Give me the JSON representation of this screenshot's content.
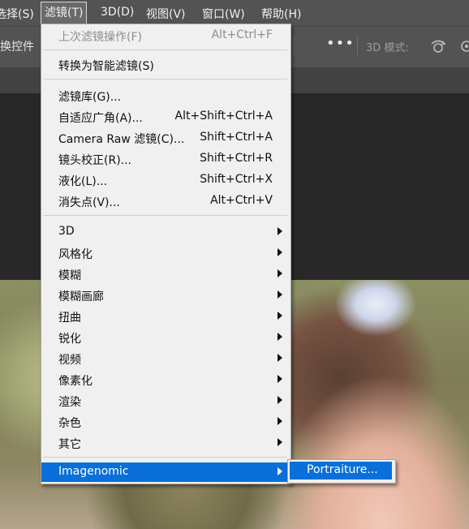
{
  "menubar": {
    "items": [
      "选择(S)",
      "滤镜(T)",
      "3D(D)",
      "视图(V)",
      "窗口(W)",
      "帮助(H)"
    ]
  },
  "options_bar": {
    "left_label": "换控件",
    "more_label": "•••",
    "mode_label": "3D 模式:"
  },
  "filter_menu": {
    "last_filter": {
      "label": "上次滤镜操作(F)",
      "shortcut": "Alt+Ctrl+F"
    },
    "convert_smart": {
      "label": "转换为智能滤镜(S)"
    },
    "group1": [
      {
        "label": "滤镜库(G)...",
        "shortcut": ""
      },
      {
        "label": "自适应广角(A)...",
        "shortcut": "Alt+Shift+Ctrl+A"
      },
      {
        "label": "Camera Raw 滤镜(C)...",
        "shortcut": "Shift+Ctrl+A"
      },
      {
        "label": "镜头校正(R)...",
        "shortcut": "Shift+Ctrl+R"
      },
      {
        "label": "液化(L)...",
        "shortcut": "Shift+Ctrl+X"
      },
      {
        "label": "消失点(V)...",
        "shortcut": "Alt+Ctrl+V"
      }
    ],
    "submenus": [
      "3D",
      "风格化",
      "模糊",
      "模糊画廊",
      "扭曲",
      "锐化",
      "视频",
      "像素化",
      "渲染",
      "杂色",
      "其它"
    ],
    "plugin": "Imagenomic"
  },
  "imagenomic_submenu": {
    "items": [
      "Portraiture..."
    ]
  }
}
